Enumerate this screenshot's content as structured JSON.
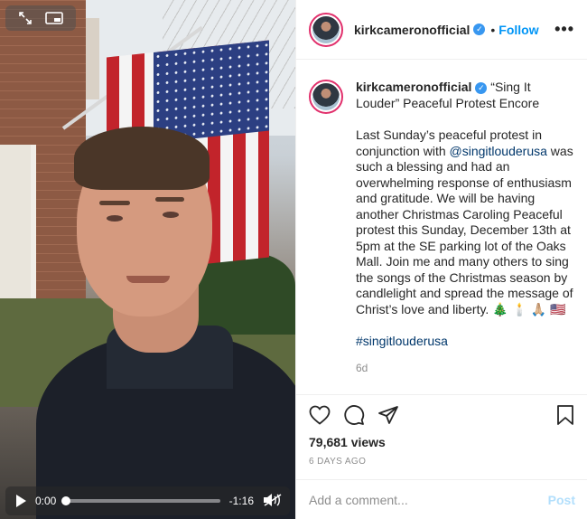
{
  "post": {
    "username": "kirkcameronofficial",
    "verified_icon": "verified-badge-icon",
    "separator": "•",
    "follow_label": "Follow",
    "more_label": "•••",
    "caption_title": "“Sing It Louder” Peaceful Protest Encore",
    "caption_part1": "Last Sunday’s peaceful protest in conjunction with ",
    "caption_mention": "@singitlouderusa",
    "caption_part2": " was such a blessing and had an overwhelming response of enthusiasm and gratitude. We will be having another Christmas Caroling Peaceful protest this Sunday, December 13th at 5pm at the SE parking lot of the Oaks Mall. Join me and many others to sing the songs of the Christmas season by candlelight and spread the message of Christ’s love and liberty. 🎄 🕯️ 🙏🏼 🇺🇸",
    "hashtag": "#singitlouderusa",
    "caption_age": "6d",
    "views": "79,681 views",
    "posted_ago": "6 DAYS AGO",
    "comment_placeholder": "Add a comment...",
    "post_label": "Post"
  },
  "video": {
    "current_time": "0:00",
    "remaining_time": "-1:16",
    "progress": 0.0,
    "muted": true
  },
  "colors": {
    "link": "#0095f6",
    "mention": "#00376b",
    "post_disabled": "#b2dffc",
    "verified": "#3897f0"
  }
}
